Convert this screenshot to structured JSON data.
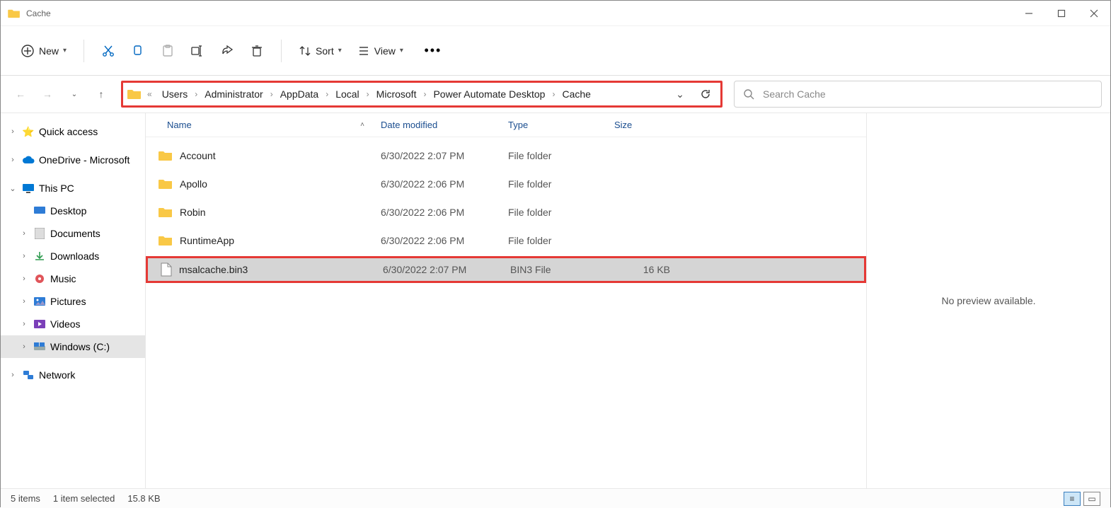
{
  "window": {
    "title": "Cache"
  },
  "toolbar": {
    "new_label": "New",
    "sort_label": "Sort",
    "view_label": "View"
  },
  "breadcrumbs": [
    "Users",
    "Administrator",
    "AppData",
    "Local",
    "Microsoft",
    "Power Automate Desktop",
    "Cache"
  ],
  "search": {
    "placeholder": "Search Cache"
  },
  "sidebar": {
    "quick_access": "Quick access",
    "onedrive": "OneDrive - Microsoft",
    "this_pc": "This PC",
    "desktop": "Desktop",
    "documents": "Documents",
    "downloads": "Downloads",
    "music": "Music",
    "pictures": "Pictures",
    "videos": "Videos",
    "windows_c": "Windows (C:)",
    "network": "Network"
  },
  "columns": {
    "name": "Name",
    "date": "Date modified",
    "type": "Type",
    "size": "Size"
  },
  "files": [
    {
      "name": "Account",
      "date": "6/30/2022 2:07 PM",
      "type": "File folder",
      "size": "",
      "kind": "folder"
    },
    {
      "name": "Apollo",
      "date": "6/30/2022 2:06 PM",
      "type": "File folder",
      "size": "",
      "kind": "folder"
    },
    {
      "name": "Robin",
      "date": "6/30/2022 2:06 PM",
      "type": "File folder",
      "size": "",
      "kind": "folder"
    },
    {
      "name": "RuntimeApp",
      "date": "6/30/2022 2:06 PM",
      "type": "File folder",
      "size": "",
      "kind": "folder"
    },
    {
      "name": "msalcache.bin3",
      "date": "6/30/2022 2:07 PM",
      "type": "BIN3 File",
      "size": "16 KB",
      "kind": "file"
    }
  ],
  "preview": {
    "text": "No preview available."
  },
  "status": {
    "count": "5 items",
    "selection": "1 item selected",
    "size": "15.8 KB"
  }
}
